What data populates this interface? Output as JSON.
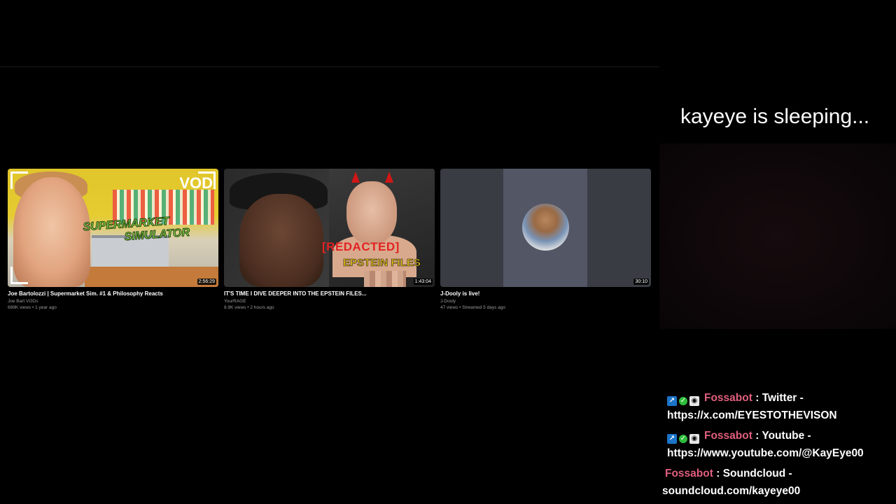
{
  "videos": [
    {
      "title": "Joe Bartolozzi | Supermarket Sim. #1 & Philosophy Reacts",
      "channel": "Joe Bart VODs",
      "meta": "689K views • 1 year ago",
      "duration": "2:56:29",
      "thumb_text": {
        "badge": "VOD",
        "line1": "SUPERMARKET",
        "line2": "SIMULATOR"
      }
    },
    {
      "title": "IT'S TIME I DIVE DEEPER INTO THE EPSTEIN FILES...",
      "channel": "YourRAGE",
      "meta": "8.9K views • 2 hours ago",
      "duration": "1:43:04",
      "thumb_text": {
        "line1": "[REDACTED]",
        "line2": "EPSTEIN FILES"
      }
    },
    {
      "title": "J-Dooly is live!",
      "channel": "J-Dooly",
      "meta": "47 views • Streamed 5 days ago",
      "duration": "30:10"
    }
  ],
  "status_text": "kayeye is sleeping...",
  "chat": {
    "username_color": "#e05f7d",
    "messages": [
      {
        "user": "Fossabot",
        "line1": "Twitter -",
        "line2": "https://x.com/EYESTOTHEVISON",
        "badges": [
          "arrow-badge-icon",
          "check-badge-icon",
          "eye-badge-icon"
        ]
      },
      {
        "user": "Fossabot",
        "line1": "Youtube -",
        "line2": "https://www.youtube.com/@KayEye00",
        "badges": [
          "arrow-badge-icon",
          "check-badge-icon",
          "eye-badge-icon"
        ]
      },
      {
        "user": "Fossabot",
        "line1": "Soundcloud -",
        "line2": "soundcloud.com/kayeye00",
        "badges": []
      }
    ]
  }
}
